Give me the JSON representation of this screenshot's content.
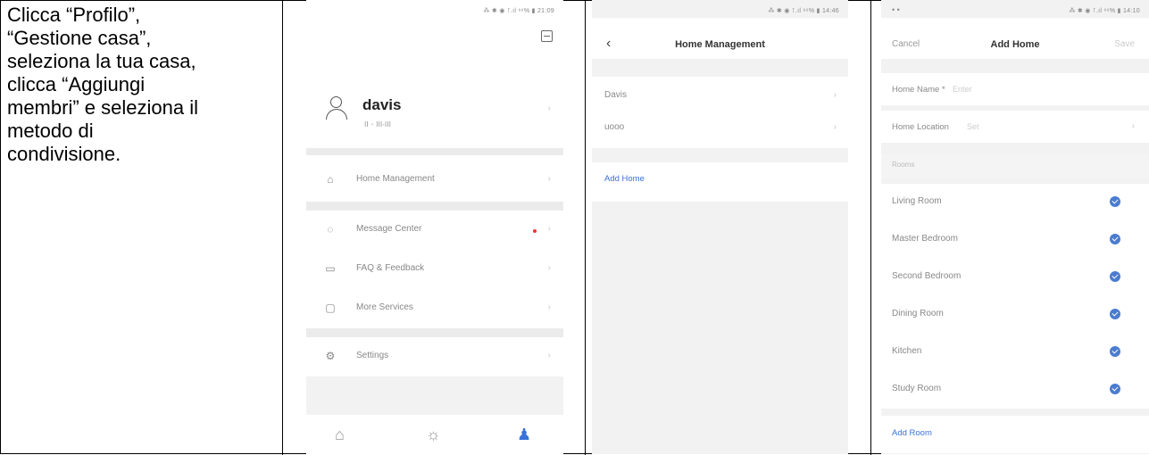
{
  "instruction": "Clicca “Profilo”,\n“Gestione casa”,\nseleziona la tua casa,\nclicca “Aggiungi\nmembri” e seleziona il\nmetodo di\ncondivisione.",
  "profile_screen": {
    "status_bar": "⁂ ✱ ◉ ⊺.ıl ⁶⁶% ▮ 21:09",
    "username": "davis",
    "user_subtitle": "ⵏⵏ ･ ⵏⵏⵏ-ⵏⵏⵏ",
    "menu": [
      {
        "icon": "home-icon",
        "label": "Home Management"
      },
      {
        "icon": "message-icon",
        "label": "Message Center"
      },
      {
        "icon": "faq-icon",
        "label": "FAQ & Feedback"
      },
      {
        "icon": "services-icon",
        "label": "More Services"
      },
      {
        "icon": "settings-icon",
        "label": "Settings"
      }
    ],
    "tabs": [
      {
        "icon": "home-tab-icon",
        "glyph": "⌂"
      },
      {
        "icon": "smart-tab-icon",
        "glyph": "☼"
      },
      {
        "icon": "profile-tab-icon",
        "glyph": "♟"
      }
    ]
  },
  "home_management_screen": {
    "status_bar": "⁂ ✱ ◉ ⊺.ıl ⁶⁶% ▮ 14:46",
    "title": "Home Management",
    "back": "‹",
    "homes": [
      "Davis",
      "uooo"
    ],
    "add_home": "Add Home"
  },
  "add_home_screen": {
    "status_bar_left": "• •",
    "status_bar": "⁂ ✱ ◉ ⊺.ıl ⁶⁶% ▮ 14:10",
    "cancel": "Cancel",
    "title": "Add Home",
    "save": "Save",
    "home_name_label": "Home Name *",
    "home_name_placeholder": "Enter",
    "home_location_label": "Home Location",
    "home_location_value": "Set",
    "rooms_header": "Rooms",
    "rooms": [
      "Living Room",
      "Master Bedroom",
      "Second Bedroom",
      "Dining Room",
      "Kitchen",
      "Study Room"
    ],
    "add_room": "Add Room"
  },
  "colors": {
    "accent": "#3a73d8",
    "check": "#4a7cd0",
    "badge": "#e33333"
  }
}
